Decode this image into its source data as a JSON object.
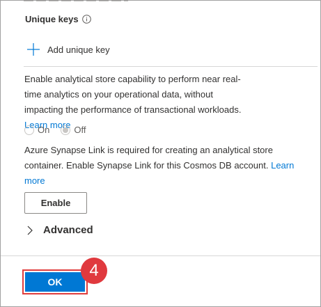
{
  "unique_keys": {
    "title": "Unique keys",
    "add_label": "Add unique key"
  },
  "analytical_store": {
    "description": "Enable analytical store capability to perform near real-time analytics on your operational data, without impacting the performance of transactional workloads.",
    "learn_more": "Learn more",
    "options": [
      {
        "label": "On",
        "checked": false
      },
      {
        "label": "Off",
        "checked": true
      }
    ]
  },
  "synapse": {
    "text": "Azure Synapse Link is required for creating an analytical store container. Enable Synapse Link for this Cosmos DB account.",
    "learn_more": "Learn more",
    "enable_label": "Enable"
  },
  "advanced": {
    "label": "Advanced"
  },
  "footer": {
    "ok_label": "OK",
    "step_number": "4"
  },
  "colors": {
    "accent": "#0078d4",
    "highlight": "#e03c3c",
    "badge": "#e0393e"
  },
  "icons": [
    "info-icon",
    "plus-icon",
    "chevron-right-icon"
  ]
}
